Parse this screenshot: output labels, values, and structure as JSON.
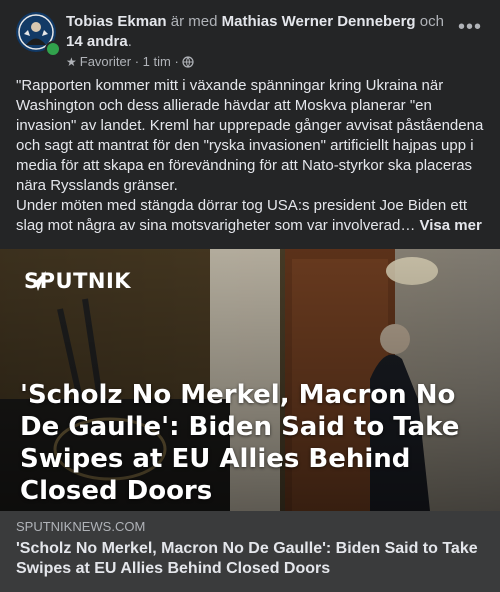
{
  "post": {
    "author": "Tobias Ekman",
    "with_text": "är med",
    "tagged": "Mathias Werner Denneberg",
    "and_text": "och",
    "others": "14 andra",
    "period": ".",
    "audience": "Favoriter",
    "dot": "·",
    "time": "1 tim",
    "more_label": "•••",
    "text_paragraph_1": "\"Rapporten kommer mitt i växande spänningar kring Ukraina när Washington och dess allierade hävdar att Moskva planerar \"en invasion\" av landet. Kreml har upprepade gånger avvisat påståendena och sagt att mantrat för den \"ryska invasionen\" artificiellt hajpas upp i media för att skapa en förevändning för att Nato-styrkor ska placeras nära Rysslands gränser.",
    "text_paragraph_2": "Under möten med stängda dörrar tog USA:s president Joe Biden ett slag mot några av sina motsvarigheter som var involverad…",
    "see_more": "Visa mer"
  },
  "link": {
    "brand": "SPUTNIK",
    "image_headline": "'Scholz No Merkel, Macron No De Gaulle': Biden Said to Take Swipes at EU Allies Behind Closed Doors",
    "domain": "SPUTNIKNEWS.COM",
    "title": "'Scholz No Merkel, Macron No De Gaulle': Biden Said to Take Swipes at EU Allies Behind Closed Doors"
  },
  "colors": {
    "card_bg": "#242526",
    "link_footer_bg": "#3a3b3c",
    "online": "#31a24c",
    "text_primary": "#e4e6eb",
    "text_secondary": "#b0b3b8"
  },
  "icons": {
    "audience": "star-icon",
    "privacy": "globe-icon",
    "menu": "more-options-icon"
  }
}
